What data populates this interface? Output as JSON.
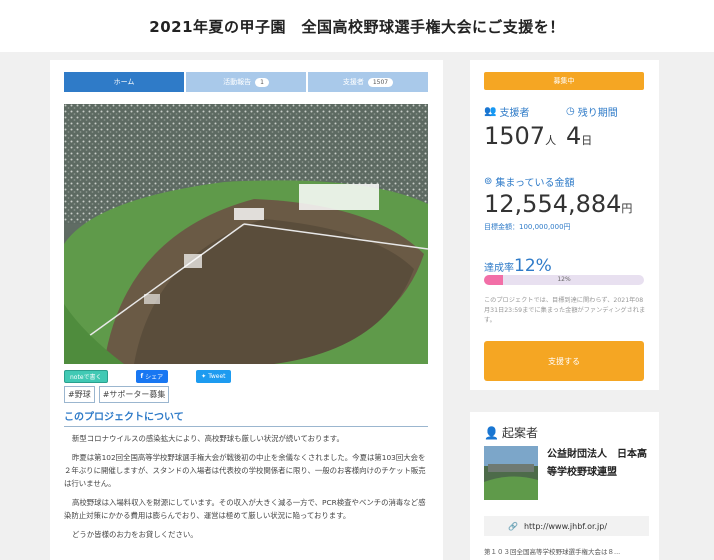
{
  "header": {
    "title": "2021年夏の甲子園　全国高校野球選手権大会にご支援を！"
  },
  "tabs": [
    {
      "label": "ホーム",
      "count": ""
    },
    {
      "label": "活動報告",
      "count": "1"
    },
    {
      "label": "支援者",
      "count": "1507"
    }
  ],
  "share": {
    "note": "noteで書く",
    "facebook": "シェア",
    "twitter": "Tweet"
  },
  "tags": [
    "#野球",
    "#サポーター募集"
  ],
  "section": {
    "heading": "このプロジェクトについて",
    "paragraphs": [
      "新型コロナウイルスの感染拡大により、高校野球も厳しい状況が続いております。",
      "昨夏は第102回全国高等学校野球選手権大会が戦後初の中止を余儀なくされました。今夏は第103回大会を２年ぶりに開催しますが、スタンドの入場者は代表校の学校関係者に限り、一般のお客様向けのチケット販売は行いません。",
      "高校野球は入場料収入を財源にしています。その収入が大きく減る一方で、PCR検査やベンチの消毒など感染防止対策にかかる費用は膨らんでおり、運営は極めて厳しい状況に陥っております。",
      "どうか皆様のお力をお貸しください。"
    ]
  },
  "side": {
    "status": "募集中",
    "supporters_label": "支援者",
    "supporters_value": "1507",
    "supporters_unit": "人",
    "remaining_label": "残り期間",
    "remaining_value": "4",
    "remaining_unit": "日",
    "amount_label": "集まっている金額",
    "amount_value": "12,554,884",
    "amount_unit": "円",
    "goal": "目標金額：100,000,000円",
    "rate_label": "達成率",
    "rate_value": "12%",
    "progress_text": "12%",
    "progress_fraction": 0.12,
    "note": "このプロジェクトでは、目標到達に関わらず、2021年08月31日23:59までに集まった金額がファンディングされます。",
    "support_button": "支援する"
  },
  "organizer": {
    "heading": "起案者",
    "name": "公益財団法人　日本高等学校野球連盟",
    "url": "http://www.jhbf.or.jp/",
    "desc": "第１０３回全国高等学校野球選手権大会は８..."
  },
  "colors": {
    "accent": "#2f7bc8",
    "button": "#f5a623",
    "progress": "#f26fa7"
  }
}
